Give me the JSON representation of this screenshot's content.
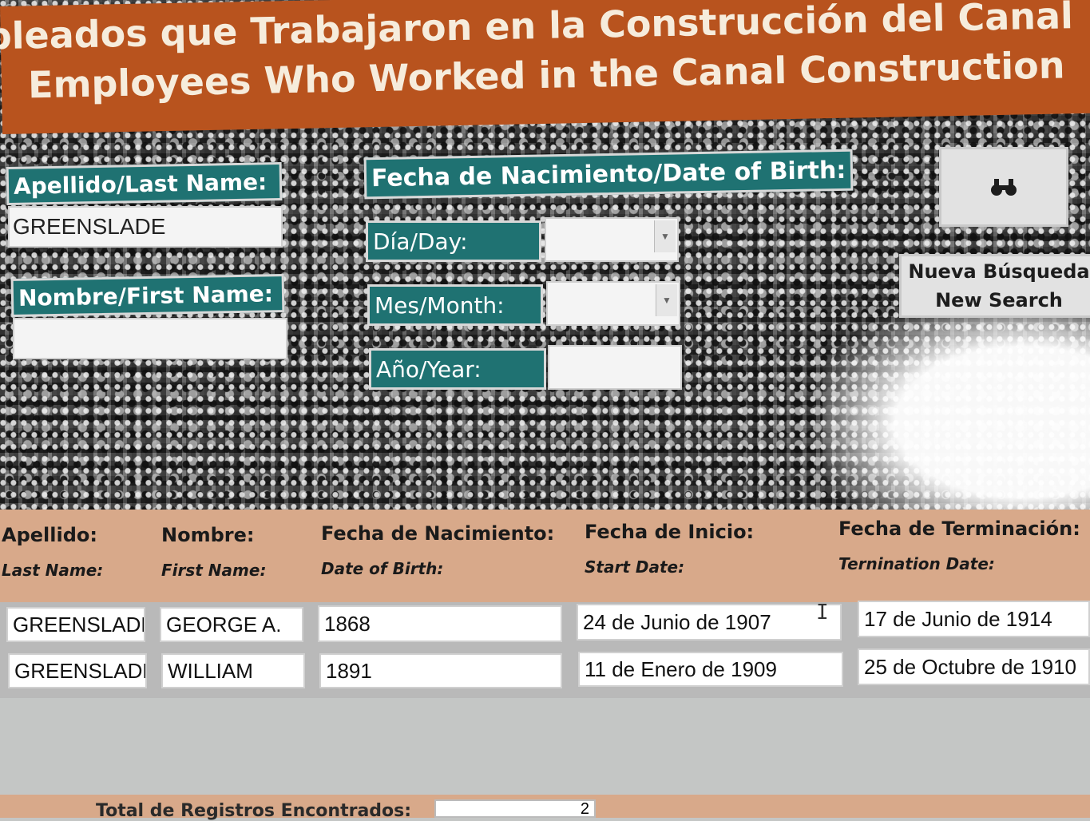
{
  "header": {
    "title_es": "Empleados que Trabajaron en la Construcción del Canal",
    "title_en": "Employees Who Worked in the Canal Construction"
  },
  "search": {
    "last_name_label": "Apellido/Last Name:",
    "last_name_value": "GREENSLADE",
    "first_name_label": "Nombre/First Name:",
    "first_name_value": "",
    "dob_label": "Fecha de Nacimiento/Date of Birth:",
    "day_label": "Día/Day:",
    "day_value": "",
    "month_label": "Mes/Month:",
    "month_value": "",
    "year_label": "Año/Year:",
    "year_value": "",
    "search_button_icon": "binoculars-icon",
    "new_search_es": "Nueva Búsqueda",
    "new_search_en": "New Search"
  },
  "results": {
    "columns": [
      {
        "es": "Apellido:",
        "en": "Last Name:"
      },
      {
        "es": "Nombre:",
        "en": "First Name:"
      },
      {
        "es": "Fecha de Nacimiento:",
        "en": "Date of Birth:"
      },
      {
        "es": "Fecha de Inicio:",
        "en": "Start Date:"
      },
      {
        "es": "Fecha de Terminación:",
        "en": "Ternination Date:"
      }
    ],
    "rows": [
      {
        "last": "GREENSLADE",
        "first": "GEORGE A.",
        "dob": "1868",
        "start": "24 de Junio de 1907",
        "end": "17 de Junio de 1914"
      },
      {
        "last": "GREENSLADE",
        "first": "WILLIAM",
        "dob": "1891",
        "start": "11 de Enero de 1909",
        "end": "25 de Octubre de 1910"
      }
    ]
  },
  "footer": {
    "total_label": "Total de Registros Encontrados:",
    "total_value": "2"
  },
  "colors": {
    "banner": "#b8531e",
    "label_teal": "#1f7272",
    "results_header": "#d8a98a"
  }
}
